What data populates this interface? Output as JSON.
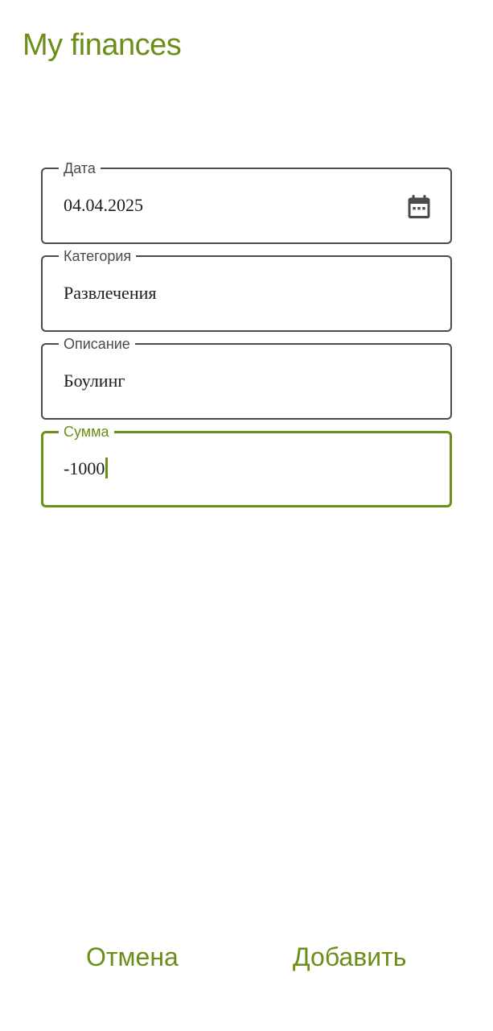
{
  "app": {
    "title": "My finances"
  },
  "form": {
    "date": {
      "label": "Дата",
      "value": "04.04.2025",
      "icon": "calendar-icon"
    },
    "category": {
      "label": "Категория",
      "value": "Развлечения"
    },
    "description": {
      "label": "Описание",
      "value": "Боулинг"
    },
    "amount": {
      "label": "Сумма",
      "value": "-1000",
      "focused": true
    }
  },
  "actions": {
    "cancel_label": "Отмена",
    "add_label": "Добавить"
  },
  "colors": {
    "accent": "#6b8e1a",
    "border": "#4a4a4f",
    "text": "#1c1c1e",
    "background": "#ffffff"
  }
}
